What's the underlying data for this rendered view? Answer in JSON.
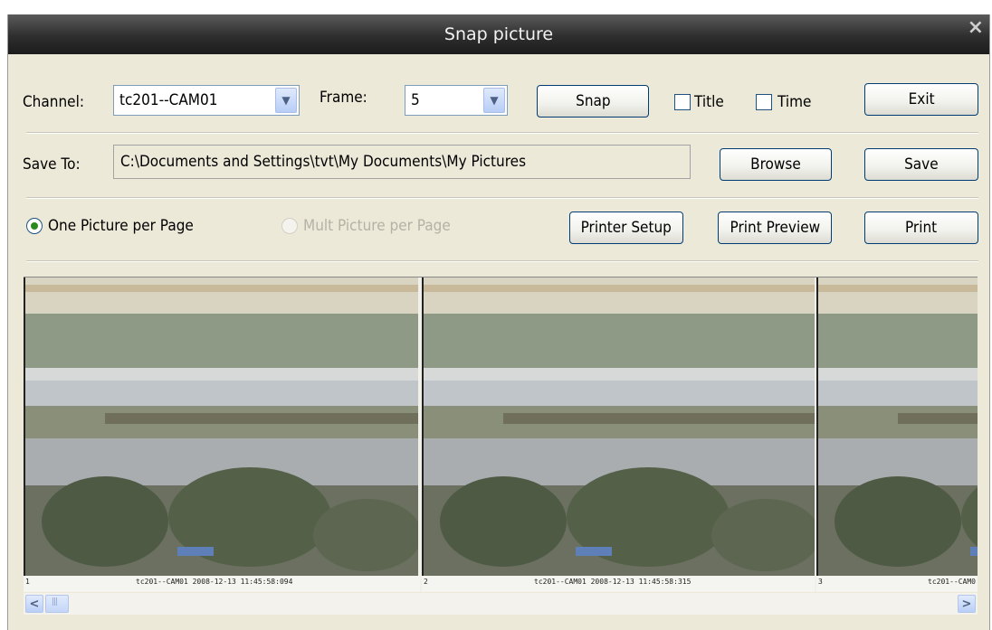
{
  "window": {
    "title": "Snap picture",
    "close_glyph": "×"
  },
  "row1": {
    "channel_label": "Channel:",
    "channel_value": "tc201--CAM01",
    "frame_label": "Frame:",
    "frame_value": "5",
    "snap_label": "Snap",
    "title_label": "Title",
    "title_checked": false,
    "time_label": "Time",
    "time_checked": false,
    "exit_label": "Exit"
  },
  "row2": {
    "save_to_label": "Save To:",
    "path_value": "C:\\Documents and Settings\\tvt\\My Documents\\My Pictures",
    "browse_label": "Browse",
    "save_label": "Save"
  },
  "row3": {
    "one_picture_label": "One Picture per Page",
    "one_picture_selected": true,
    "mult_picture_label": "Mult Picture per Page",
    "mult_picture_enabled": false,
    "printer_setup_label": "Printer Setup",
    "print_preview_label": "Print Preview",
    "print_label": "Print"
  },
  "pictures": [
    {
      "index": "1",
      "caption": "tc201--CAM01   2008-12-13 11:45:58:094"
    },
    {
      "index": "2",
      "caption": "tc201--CAM01   2008-12-13 11:45:58:315"
    },
    {
      "index": "3",
      "caption": "tc201--CAM0"
    }
  ],
  "icons": {
    "dropdown": "chevron-down-icon",
    "scroll_left": "chevron-left-icon",
    "scroll_right": "chevron-right-icon"
  },
  "colors": {
    "titlebar": "#2e2e2e",
    "dialog_bg": "#ece9d8",
    "button_border": "#003c74",
    "radio_dot": "#2b8a1e"
  }
}
